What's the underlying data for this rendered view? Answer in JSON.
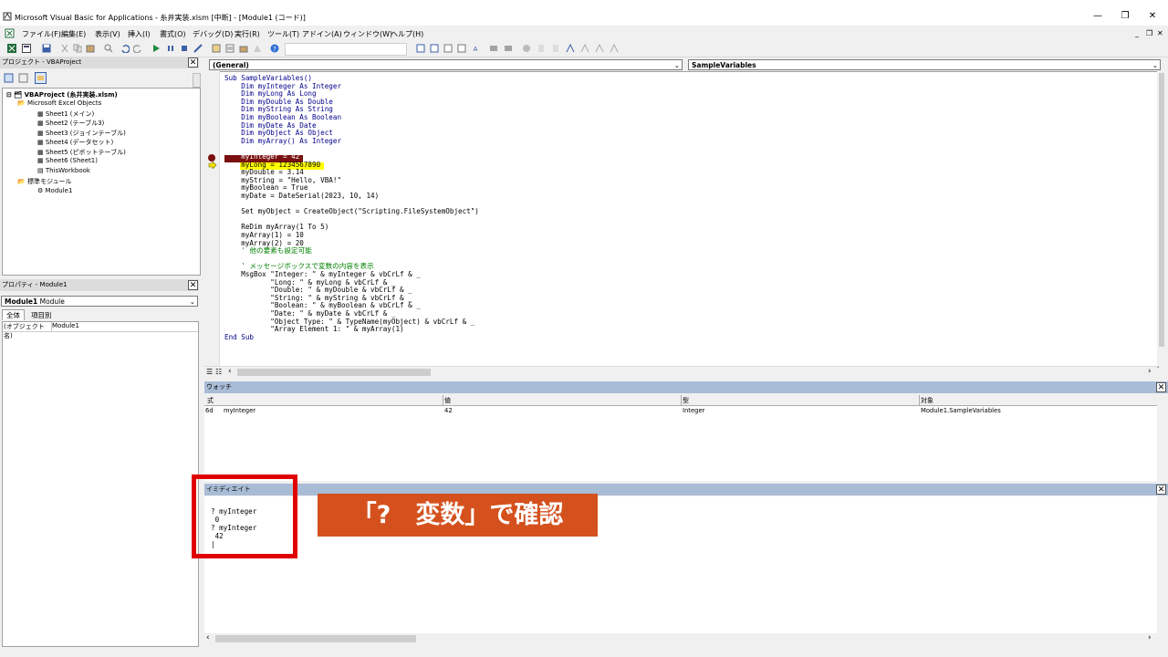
{
  "window": {
    "title": "Microsoft Visual Basic for Applications - 糸井実装.xlsm [中断] - [Module1 (コード)]",
    "buttons": [
      "—",
      "❐",
      "✕"
    ],
    "mdi_buttons": [
      "_",
      "❐",
      "✕"
    ]
  },
  "menu": [
    "ファイル(F)",
    "編集(E)",
    "表示(V)",
    "挿入(I)",
    "書式(O)",
    "デバッグ(D)",
    "実行(R)",
    "ツール(T)",
    "アドイン(A)",
    "ウィンドウ(W)",
    "ヘルプ(H)"
  ],
  "project": {
    "title": "プロジェクト - VBAProject",
    "tree": [
      "VBAProject (糸井実装.xlsm)",
      "Microsoft Excel Objects",
      "Sheet1 (メイン)",
      "Sheet2 (テーブル3)",
      "Sheet3 (ジョインテーブル)",
      "Sheet4 (データセット)",
      "Sheet5 (ピボットテーブル)",
      "Sheet6 (Sheet1)",
      "ThisWorkbook",
      "標準モジュール",
      "Module1"
    ]
  },
  "properties": {
    "title": "プロパティ - Module1",
    "object_name": "Module1",
    "object_type": "Module",
    "tabs": [
      "全体",
      "項目別"
    ],
    "rows": [
      {
        "name": "(オブジェクト名)",
        "value": "Module1"
      }
    ]
  },
  "code": {
    "object_combo": "(General)",
    "proc_combo": "SampleVariables",
    "lines": [
      "Sub SampleVariables()",
      "    Dim myInteger As Integer",
      "    Dim myLong As Long",
      "    Dim myDouble As Double",
      "    Dim myString As String",
      "    Dim myBoolean As Boolean",
      "    Dim myDate As Date",
      "    Dim myObject As Object",
      "    Dim myArray() As Integer",
      "",
      "    myInteger = 42",
      "    myLong = 1234567890",
      "    myDouble = 3.14",
      "    myString = \"Hello, VBA!\"",
      "    myBoolean = True",
      "    myDate = DateSerial(2023, 10, 14)",
      "",
      "    Set myObject = CreateObject(\"Scripting.FileSystemObject\")",
      "",
      "    ReDim myArray(1 To 5)",
      "    myArray(1) = 10",
      "    myArray(2) = 20",
      "    ' 他の要素も設定可能",
      "",
      "    ' メッセージボックスで変数の内容を表示",
      "    MsgBox \"Integer: \" & myInteger & vbCrLf & _",
      "           \"Long: \" & myLong & vbCrLf & _",
      "           \"Double: \" & myDouble & vbCrLf & _",
      "           \"String: \" & myString & vbCrLf & _",
      "           \"Boolean: \" & myBoolean & vbCrLf & _",
      "           \"Date: \" & myDate & vbCrLf & _",
      "           \"Object Type: \" & TypeName(myObject) & vbCrLf & _",
      "           \"Array Element 1: \" & myArray(1)",
      "End Sub"
    ]
  },
  "watch": {
    "title": "ウォッチ",
    "columns": [
      "式",
      "値",
      "型",
      "対象"
    ],
    "row": {
      "icon": "6d",
      "expr": "myInteger",
      "value": "42",
      "type": "Integer",
      "context": "Module1.SampleVariables"
    }
  },
  "immediate": {
    "title": "イミディエイト",
    "lines": [
      "? myInteger",
      " 0",
      "? myInteger",
      " 42",
      "|"
    ]
  },
  "callout": {
    "text": "「?　変数」で確認",
    "bg_color": "#d4511e",
    "box_color": "#e00000"
  }
}
